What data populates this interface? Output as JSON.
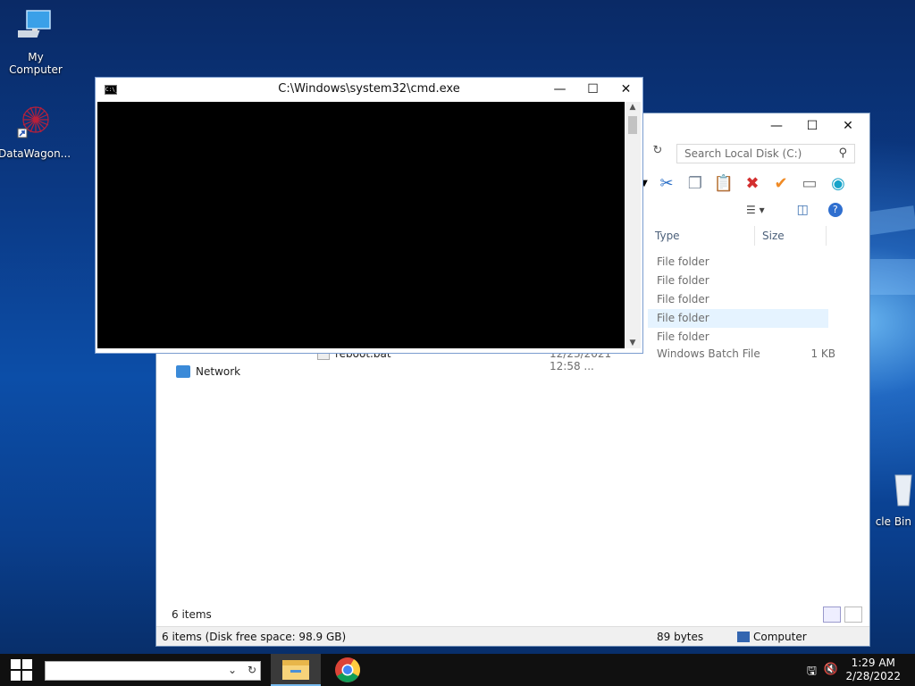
{
  "desktop": {
    "icons": [
      {
        "label": "My Computer",
        "icon": "computer-icon"
      },
      {
        "label": "DataWagon...",
        "icon": "datawagon-icon"
      },
      {
        "label": "cle Bin",
        "icon": "recycle-bin-icon"
      }
    ]
  },
  "explorer": {
    "search_placeholder": "Search Local Disk (C:)",
    "columns": [
      "Type",
      "Size"
    ],
    "rows": [
      {
        "type": "File folder",
        "size": ""
      },
      {
        "type": "File folder",
        "size": ""
      },
      {
        "type": "File folder",
        "size": ""
      },
      {
        "type": "File folder",
        "size": "",
        "selected": true
      },
      {
        "type": "File folder",
        "size": ""
      }
    ],
    "file": {
      "name": "reboot.bat",
      "date": "12/23/2021 12:58 ...",
      "type": "Windows Batch File",
      "size": "1 KB"
    },
    "nav_network": "Network",
    "item_count": "6 items",
    "status_left": "6 items (Disk free space: 98.9 GB)",
    "status_mid": "89 bytes",
    "status_right": "Computer"
  },
  "cmd": {
    "title": "C:\\Windows\\system32\\cmd.exe",
    "icon_text": "C:\\_"
  },
  "taskbar": {
    "time": "1:29 AM",
    "date": "2/28/2022"
  }
}
